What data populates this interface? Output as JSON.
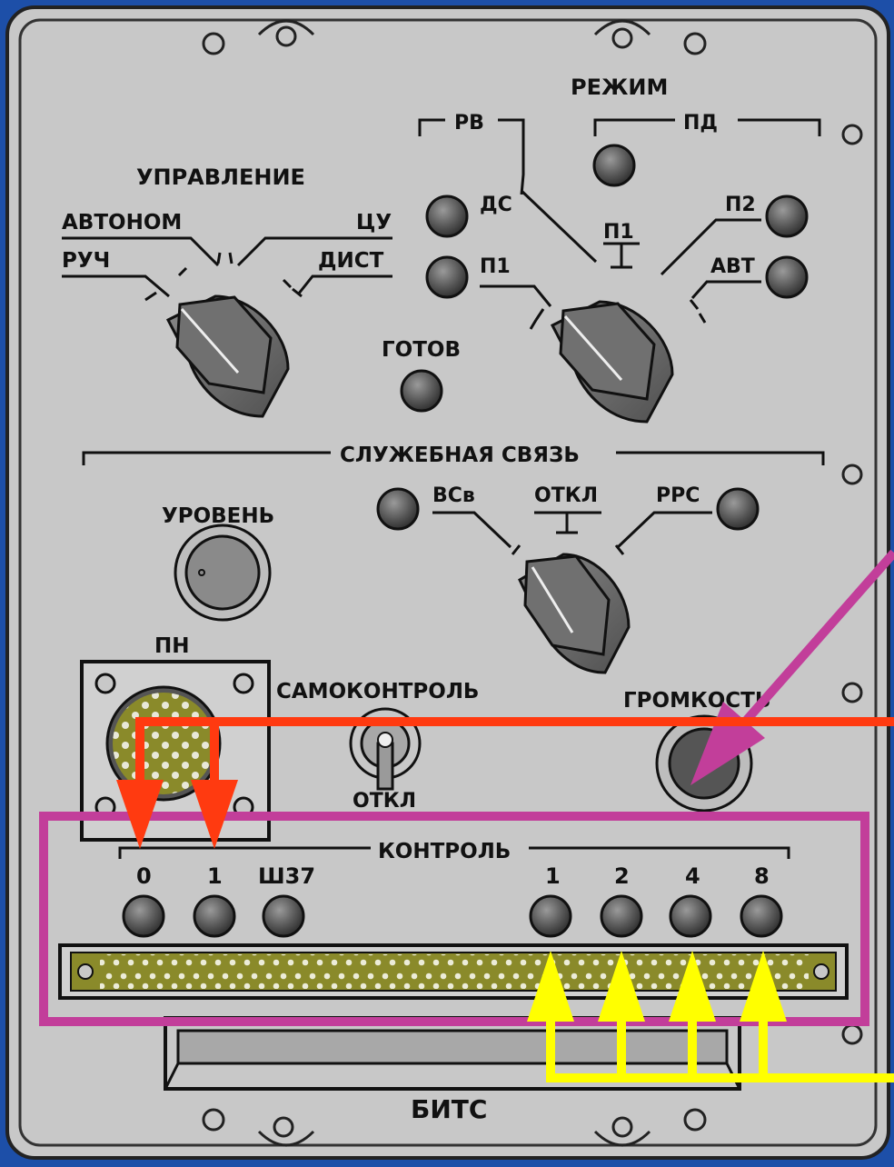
{
  "colors": {
    "background": "#1d4fa8",
    "panel": "#c8c8c8",
    "highlight_box": "#c23e9a",
    "arrow_red": "#ff3a10",
    "arrow_yellow": "#ffff00",
    "arrow_magenta": "#c23e9a",
    "connector_green": "#8a8a2a"
  },
  "labels": {
    "rezhim": "РЕЖИМ",
    "rv": "РВ",
    "pd": "ПД",
    "upravlenie": "УПРАВЛЕНИЕ",
    "avtonom": "АВТОНОМ",
    "tsu": "ЦУ",
    "ruch": "РУЧ",
    "dist": "ДИСТ",
    "ds": "ДС",
    "p1_left": "П1",
    "p1_center": "П1",
    "p2": "П2",
    "avt": "АВТ",
    "gotov": "ГОТОВ",
    "sluzhebnaya_svyaz": "СЛУЖЕБНАЯ СВЯЗЬ",
    "vsv": "ВСв",
    "otkl_center": "ОТКЛ",
    "rrs": "РРС",
    "uroven": "УРОВЕНЬ",
    "pn": "ПН",
    "samokontrol": "САМОКОНТРОЛЬ",
    "otkl_toggle": "ОТКЛ",
    "gromkost": "ГРОМКОСТЬ",
    "kontrol": "КОНТРОЛЬ",
    "k0": "0",
    "k1": "1",
    "sh37": "Ш37",
    "b1": "1",
    "b2": "2",
    "b4": "4",
    "b8": "8",
    "bits": "БИТС"
  },
  "icons": {
    "knob": "rotary-switch-icon",
    "indicator": "indicator-lamp-icon",
    "connector": "round-connector-icon",
    "toggle": "toggle-switch-icon",
    "arrow": "arrow-icon"
  }
}
